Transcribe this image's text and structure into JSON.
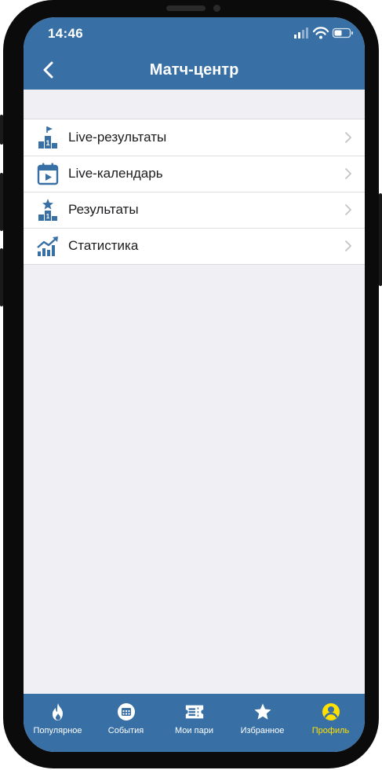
{
  "status_bar": {
    "time": "14:46"
  },
  "header": {
    "title": "Матч-центр"
  },
  "menu": {
    "items": [
      {
        "label": "Live-результаты"
      },
      {
        "label": "Live-календарь"
      },
      {
        "label": "Результаты"
      },
      {
        "label": "Статистика"
      }
    ]
  },
  "tabbar": {
    "items": [
      {
        "label": "Популярное",
        "icon": "flame-icon"
      },
      {
        "label": "События",
        "icon": "calendar-icon"
      },
      {
        "label": "Мои пари",
        "icon": "ticket-icon"
      },
      {
        "label": "Избранное",
        "icon": "star-icon"
      },
      {
        "label": "Профиль",
        "icon": "user-icon"
      }
    ],
    "active": "Профиль"
  },
  "colors": {
    "brand": "#3870a6",
    "active_tab": "#ffe000",
    "background": "#efeff4"
  }
}
